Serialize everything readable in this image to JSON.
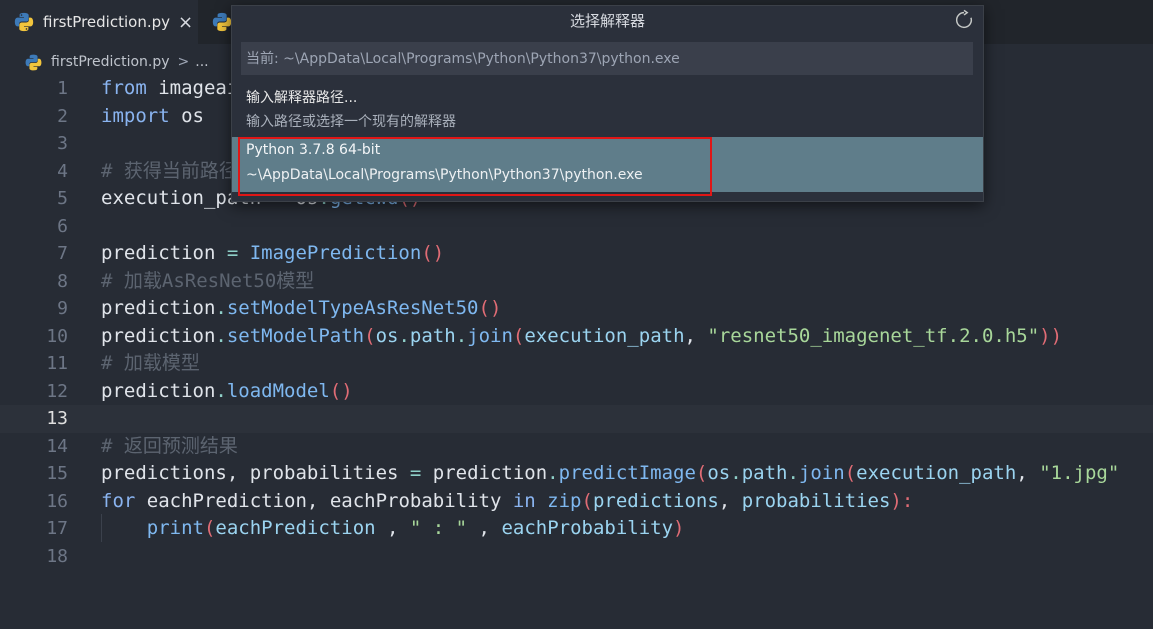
{
  "tabs": [
    {
      "label": "firstPrediction.py",
      "icon": "python-icon",
      "active": true,
      "close": "×"
    },
    {
      "label": "",
      "icon": "python-icon",
      "active": false
    }
  ],
  "breadcrumb": {
    "file": "firstPrediction.py",
    "separator": ">",
    "ellipsis": "..."
  },
  "editor": {
    "current_line": 13,
    "lines": [
      {
        "n": "1",
        "tokens": [
          {
            "t": "from",
            "c": "kw"
          },
          {
            "t": " imageai",
            "c": "pn"
          }
        ]
      },
      {
        "n": "2",
        "tokens": [
          {
            "t": "import",
            "c": "kw"
          },
          {
            "t": " os",
            "c": "pn"
          }
        ]
      },
      {
        "n": "3",
        "tokens": []
      },
      {
        "n": "4",
        "tokens": [
          {
            "t": "# 获得当前路径",
            "c": "cm"
          }
        ]
      },
      {
        "n": "5",
        "tokens": [
          {
            "t": "execution_path",
            "c": "pn"
          },
          {
            "t": " = ",
            "c": "op"
          },
          {
            "t": "os",
            "c": "pn"
          },
          {
            "t": ".",
            "c": "op"
          },
          {
            "t": "getcwd",
            "c": "fn"
          },
          {
            "t": "()",
            "c": "pr"
          }
        ]
      },
      {
        "n": "6",
        "tokens": []
      },
      {
        "n": "7",
        "tokens": [
          {
            "t": "prediction",
            "c": "pn"
          },
          {
            "t": " = ",
            "c": "op"
          },
          {
            "t": "ImagePrediction",
            "c": "fn"
          },
          {
            "t": "()",
            "c": "pr"
          }
        ]
      },
      {
        "n": "8",
        "tokens": [
          {
            "t": "# 加载AsResNet50模型",
            "c": "cm"
          }
        ]
      },
      {
        "n": "9",
        "tokens": [
          {
            "t": "prediction",
            "c": "pn"
          },
          {
            "t": ".",
            "c": "op"
          },
          {
            "t": "setModelTypeAsResNet50",
            "c": "fn"
          },
          {
            "t": "()",
            "c": "pr"
          }
        ]
      },
      {
        "n": "10",
        "tokens": [
          {
            "t": "prediction",
            "c": "pn"
          },
          {
            "t": ".",
            "c": "op"
          },
          {
            "t": "setModelPath",
            "c": "fn"
          },
          {
            "t": "(",
            "c": "pr"
          },
          {
            "t": "os",
            "c": "builtin"
          },
          {
            "t": ".",
            "c": "op"
          },
          {
            "t": "path",
            "c": "builtin"
          },
          {
            "t": ".",
            "c": "op"
          },
          {
            "t": "join",
            "c": "fn"
          },
          {
            "t": "(",
            "c": "pr"
          },
          {
            "t": "execution_path",
            "c": "builtin"
          },
          {
            "t": ", ",
            "c": "pn"
          },
          {
            "t": "\"resnet50_imagenet_tf.2.0.h5\"",
            "c": "st"
          },
          {
            "t": "))",
            "c": "pr"
          }
        ]
      },
      {
        "n": "11",
        "tokens": [
          {
            "t": "# 加载模型",
            "c": "cm"
          }
        ]
      },
      {
        "n": "12",
        "tokens": [
          {
            "t": "prediction",
            "c": "pn"
          },
          {
            "t": ".",
            "c": "op"
          },
          {
            "t": "loadModel",
            "c": "fn"
          },
          {
            "t": "()",
            "c": "pr"
          }
        ]
      },
      {
        "n": "13",
        "tokens": []
      },
      {
        "n": "14",
        "tokens": [
          {
            "t": "# 返回预测结果",
            "c": "cm"
          }
        ]
      },
      {
        "n": "15",
        "tokens": [
          {
            "t": "predictions",
            "c": "pn"
          },
          {
            "t": ", ",
            "c": "pn"
          },
          {
            "t": "probabilities",
            "c": "pn"
          },
          {
            "t": " = ",
            "c": "op"
          },
          {
            "t": "prediction",
            "c": "pn"
          },
          {
            "t": ".",
            "c": "op"
          },
          {
            "t": "predictImage",
            "c": "fn"
          },
          {
            "t": "(",
            "c": "pr"
          },
          {
            "t": "os",
            "c": "builtin"
          },
          {
            "t": ".",
            "c": "op"
          },
          {
            "t": "path",
            "c": "builtin"
          },
          {
            "t": ".",
            "c": "op"
          },
          {
            "t": "join",
            "c": "fn"
          },
          {
            "t": "(",
            "c": "pr"
          },
          {
            "t": "execution_path",
            "c": "builtin"
          },
          {
            "t": ", ",
            "c": "pn"
          },
          {
            "t": "\"1.jpg\"",
            "c": "st"
          }
        ]
      },
      {
        "n": "16",
        "tokens": [
          {
            "t": "for",
            "c": "kw"
          },
          {
            "t": " eachPrediction",
            "c": "pn"
          },
          {
            "t": ", ",
            "c": "pn"
          },
          {
            "t": "eachProbability",
            "c": "pn"
          },
          {
            "t": " in ",
            "c": "kw"
          },
          {
            "t": "zip",
            "c": "fn"
          },
          {
            "t": "(",
            "c": "pr"
          },
          {
            "t": "predictions",
            "c": "builtin"
          },
          {
            "t": ", ",
            "c": "pn"
          },
          {
            "t": "probabilities",
            "c": "builtin"
          },
          {
            "t": "):",
            "c": "pr"
          }
        ]
      },
      {
        "n": "17",
        "tokens": [
          {
            "t": "    ",
            "c": "pn"
          },
          {
            "t": "print",
            "c": "fn"
          },
          {
            "t": "(",
            "c": "pr"
          },
          {
            "t": "eachPrediction",
            "c": "builtin"
          },
          {
            "t": " , ",
            "c": "pn"
          },
          {
            "t": "\" : \"",
            "c": "st"
          },
          {
            "t": " , ",
            "c": "pn"
          },
          {
            "t": "eachProbability",
            "c": "builtin"
          },
          {
            "t": ")",
            "c": "pr"
          }
        ]
      },
      {
        "n": "18",
        "tokens": []
      }
    ]
  },
  "quickpick": {
    "title": "选择解释器",
    "refresh_icon": "refresh-icon",
    "placeholder": "当前: ~\\AppData\\Local\\Programs\\Python\\Python37\\python.exe",
    "items": [
      {
        "label": "输入解释器路径...",
        "description": "输入路径或选择一个现有的解释器",
        "selected": false
      },
      {
        "label": "Python 3.7.8 64-bit",
        "description": "~\\AppData\\Local\\Programs\\Python\\Python37\\python.exe",
        "selected": true
      }
    ]
  },
  "colors": {
    "editor_bg": "#272c35",
    "selection_bg": "#5f7d8a",
    "annotation_box": "#e01616"
  }
}
